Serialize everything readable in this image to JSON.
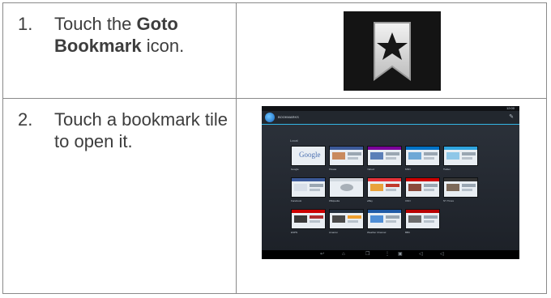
{
  "steps": [
    {
      "number": "1.",
      "pre": "Touch the ",
      "bold": "Goto Bookmark",
      "post": " icon."
    },
    {
      "number": "2.",
      "text": "Touch a bookmark tile to open it."
    }
  ],
  "icons": {
    "bookmark": "bookmark-star-icon"
  },
  "tablet": {
    "header_title": "BOOKMARKS",
    "status_time": "12:00",
    "folder_label": "Local",
    "tiles": [
      {
        "label": "Google",
        "accent": "#ffffff"
      },
      {
        "label": "Picasa",
        "accent": "#3b5998"
      },
      {
        "label": "Yahoo!",
        "accent": "#7b0099"
      },
      {
        "label": "MSN",
        "accent": "#0072c6"
      },
      {
        "label": "Twitter",
        "accent": "#2fa4de"
      },
      {
        "label": "Facebook",
        "accent": "#3b5998"
      },
      {
        "label": "Wikipedia",
        "accent": "#cfd6dd"
      },
      {
        "label": "eBay",
        "accent": "#e53238"
      },
      {
        "label": "CNN",
        "accent": "#cc0000"
      },
      {
        "label": "NY Times",
        "accent": "#333333"
      },
      {
        "label": "ESPN",
        "accent": "#cc0000"
      },
      {
        "label": "Amazon",
        "accent": "#232f3e"
      },
      {
        "label": "Weather Channel",
        "accent": "#1f5aa6"
      },
      {
        "label": "BBC",
        "accent": "#b80000"
      }
    ]
  },
  "colors": {
    "accent_blue": "#33b5e5",
    "border": "#8a8a8a",
    "text": "#3d3d3d"
  }
}
